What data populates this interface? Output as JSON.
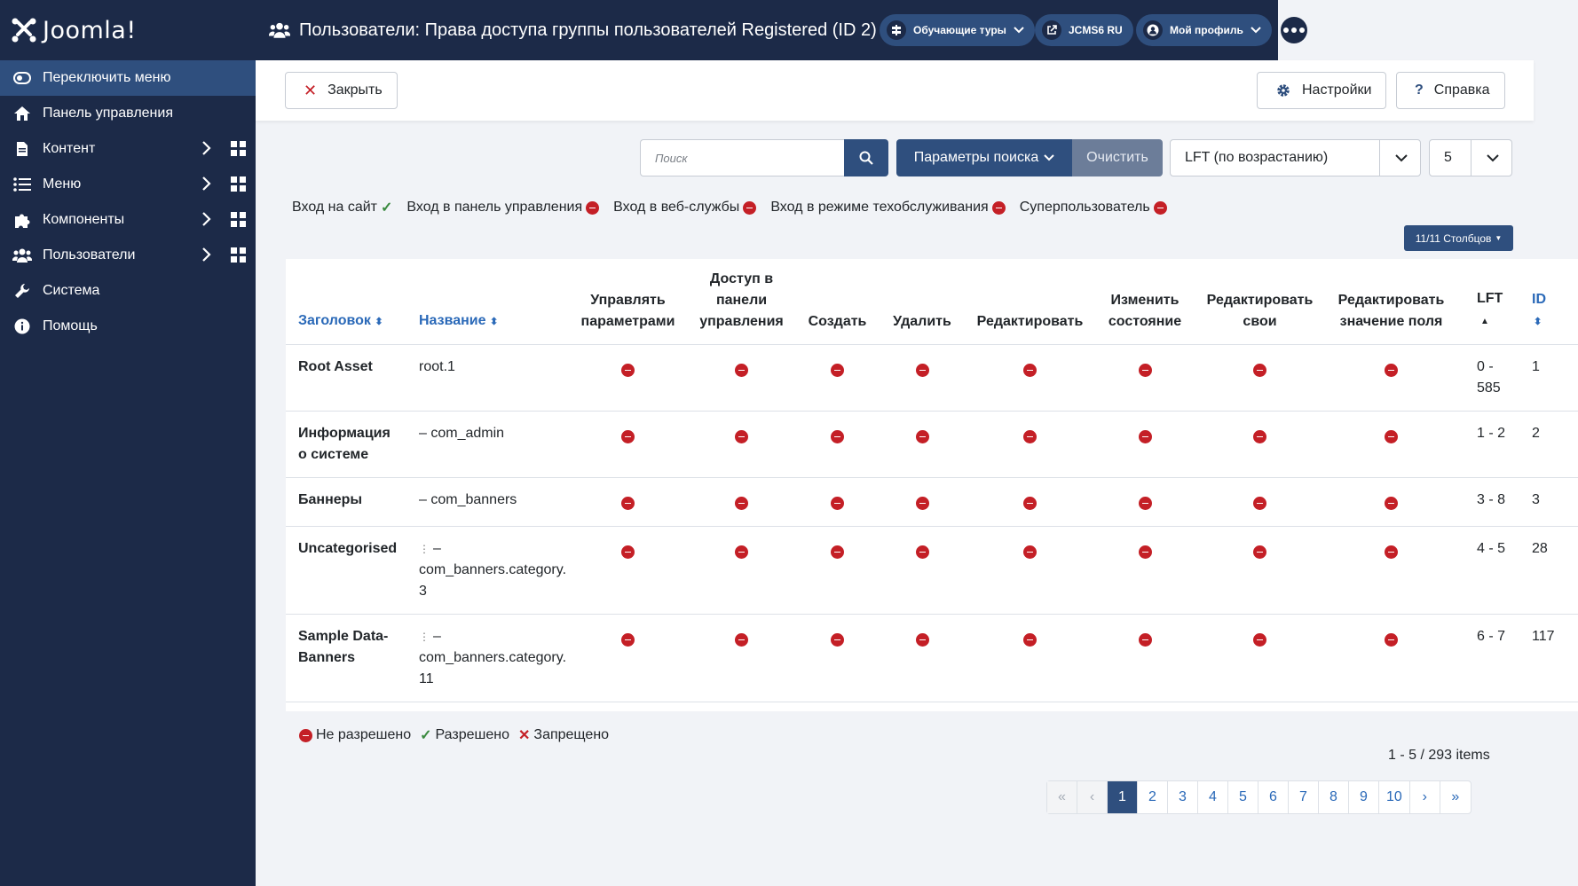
{
  "sidebar": {
    "logo_text": "Joomla!",
    "items": [
      {
        "label": "Переключить меню",
        "icon": "toggle-icon"
      },
      {
        "label": "Панель управления",
        "icon": "home-icon"
      },
      {
        "label": "Контент",
        "icon": "file-icon"
      },
      {
        "label": "Меню",
        "icon": "list-icon"
      },
      {
        "label": "Компоненты",
        "icon": "puzzle-icon"
      },
      {
        "label": "Пользователи",
        "icon": "users-icon"
      },
      {
        "label": "Система",
        "icon": "wrench-icon"
      },
      {
        "label": "Помощь",
        "icon": "info-icon"
      }
    ]
  },
  "header": {
    "title": "Пользователи: Права доступа группы пользователей Registered (ID 2)",
    "tours_label": "Обучающие туры",
    "site_label": "JCMS6 RU",
    "profile_label": "Мой профиль"
  },
  "toolbar": {
    "close_label": "Закрыть",
    "options_label": "Настройки",
    "help_label": "Справка"
  },
  "search": {
    "placeholder": "Поиск",
    "filter_options_label": "Параметры поиска",
    "clear_label": "Очистить",
    "ordering_value": "LFT (по возрастанию)",
    "limit_value": "5"
  },
  "legend_top": {
    "site_login": "Вход на сайт",
    "admin_login": "Вход в панель управления",
    "api_login": "Вход в веб-службы",
    "offline_login": "Вход в режиме техобслуживания",
    "super_user": "Суперпользователь"
  },
  "columns_button": "11/11 Столбцов",
  "table": {
    "headers": {
      "title": "Заголовок",
      "name": "Название",
      "admin": "Управлять параметрами",
      "manage": "Доступ в панели управления",
      "create": "Создать",
      "delete": "Удалить",
      "edit": "Редактировать",
      "edit_state": "Изменить состояние",
      "edit_own": "Редактировать свои",
      "edit_value": "Редактировать значение поля",
      "lft": "LFT",
      "id": "ID"
    },
    "rows": [
      {
        "title": "Root Asset",
        "name": "root.1",
        "lft": "0 - 585",
        "id": "1"
      },
      {
        "title": "Информация о системе",
        "name": "– com_admin",
        "lft": "1 - 2",
        "id": "2"
      },
      {
        "title": "Баннеры",
        "name": "– com_banners",
        "lft": "3 - 8",
        "id": "3"
      },
      {
        "title": "Uncategorised",
        "name": "– com_banners.category. 3",
        "lft": "4 - 5",
        "id": "28"
      },
      {
        "title": "Sample Data-Banners",
        "name": "– com_banners.category. 11",
        "lft": "6 - 7",
        "id": "117"
      }
    ]
  },
  "legend_bottom": {
    "not_allowed": "Не разрешено",
    "allowed": "Разрешено",
    "denied": "Запрещено"
  },
  "pagination": {
    "summary": "1 - 5 / 293 items",
    "pages": [
      "1",
      "2",
      "3",
      "4",
      "5",
      "6",
      "7",
      "8",
      "9",
      "10"
    ]
  },
  "colors": {
    "sidebar_bg": "#1c2a48",
    "accent": "#2f4f7e",
    "deny": "#c41f26",
    "allow": "#3a8a3f",
    "link": "#2a69b8"
  }
}
